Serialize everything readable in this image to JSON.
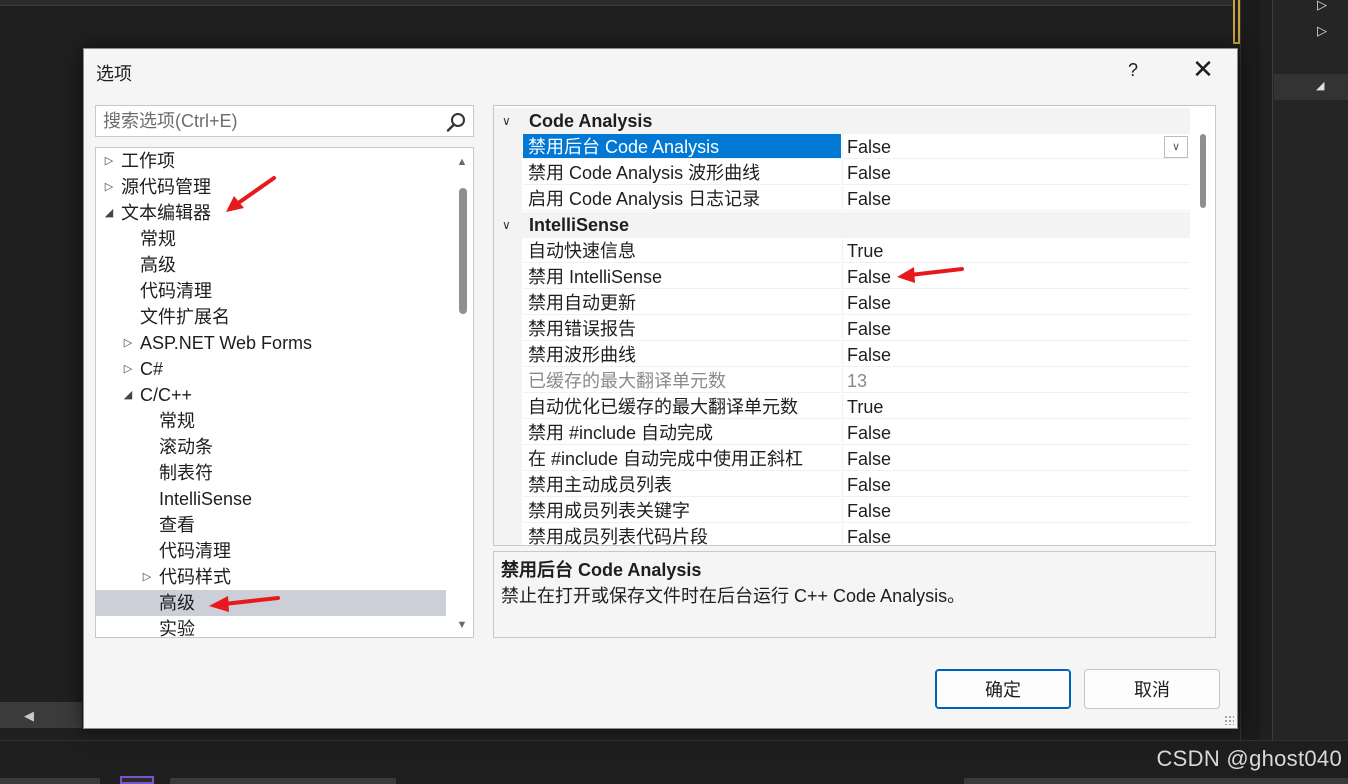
{
  "dialog": {
    "title": "选项",
    "help_label": "?",
    "close_label": "✕",
    "search_placeholder": "搜索选项(Ctrl+E)"
  },
  "tree": {
    "items": [
      {
        "label": "工作项",
        "level": 0,
        "state": "collapsed"
      },
      {
        "label": "源代码管理",
        "level": 0,
        "state": "collapsed"
      },
      {
        "label": "文本编辑器",
        "level": 0,
        "state": "expanded"
      },
      {
        "label": "常规",
        "level": 1,
        "state": "leaf"
      },
      {
        "label": "高级",
        "level": 1,
        "state": "leaf"
      },
      {
        "label": "代码清理",
        "level": 1,
        "state": "leaf"
      },
      {
        "label": "文件扩展名",
        "level": 1,
        "state": "leaf"
      },
      {
        "label": "ASP.NET Web Forms",
        "level": 1,
        "state": "collapsed"
      },
      {
        "label": "C#",
        "level": 1,
        "state": "collapsed"
      },
      {
        "label": "C/C++",
        "level": 1,
        "state": "expanded"
      },
      {
        "label": "常规",
        "level": 2,
        "state": "leaf"
      },
      {
        "label": "滚动条",
        "level": 2,
        "state": "leaf"
      },
      {
        "label": "制表符",
        "level": 2,
        "state": "leaf"
      },
      {
        "label": "IntelliSense",
        "level": 2,
        "state": "leaf"
      },
      {
        "label": "查看",
        "level": 2,
        "state": "leaf"
      },
      {
        "label": "代码清理",
        "level": 2,
        "state": "leaf"
      },
      {
        "label": "代码样式",
        "level": 2,
        "state": "collapsed"
      },
      {
        "label": "高级",
        "level": 2,
        "state": "leaf",
        "selected": true
      },
      {
        "label": "实验",
        "level": 2,
        "state": "leaf"
      }
    ]
  },
  "grid": {
    "sections": [
      {
        "title": "Code Analysis",
        "rows": [
          {
            "name": "禁用后台 Code Analysis",
            "value": "False",
            "selected": true
          },
          {
            "name": "禁用 Code Analysis 波形曲线",
            "value": "False"
          },
          {
            "name": "启用 Code Analysis 日志记录",
            "value": "False"
          }
        ]
      },
      {
        "title": "IntelliSense",
        "rows": [
          {
            "name": "自动快速信息",
            "value": "True"
          },
          {
            "name": "禁用 IntelliSense",
            "value": "False"
          },
          {
            "name": "禁用自动更新",
            "value": "False"
          },
          {
            "name": "禁用错误报告",
            "value": "False"
          },
          {
            "name": "禁用波形曲线",
            "value": "False"
          },
          {
            "name": "已缓存的最大翻译单元数",
            "value": "13",
            "disabled": true
          },
          {
            "name": "自动优化已缓存的最大翻译单元数",
            "value": "True"
          },
          {
            "name": "禁用 #include 自动完成",
            "value": "False"
          },
          {
            "name": "在 #include 自动完成中使用正斜杠",
            "value": "False"
          },
          {
            "name": "禁用主动成员列表",
            "value": "False"
          },
          {
            "name": "禁用成员列表关键字",
            "value": "False"
          },
          {
            "name": "禁用成员列表代码片段",
            "value": "False"
          }
        ]
      }
    ]
  },
  "description": {
    "title": "禁用后台 Code Analysis",
    "text": "禁止在打开或保存文件时在后台运行 C++ Code Analysis。"
  },
  "buttons": {
    "ok": "确定",
    "cancel": "取消"
  },
  "watermark": "CSDN @ghost040",
  "colors": {
    "selection_blue": "#0078d4",
    "tree_selection": "#ccced8",
    "annotation_red": "#e8191c",
    "backdrop": "#1f1f1f"
  },
  "icons": {
    "search": "search-icon",
    "expand": "triangle-right-icon",
    "collapse": "triangle-down-icon",
    "dropdown": "chevron-down-icon"
  }
}
